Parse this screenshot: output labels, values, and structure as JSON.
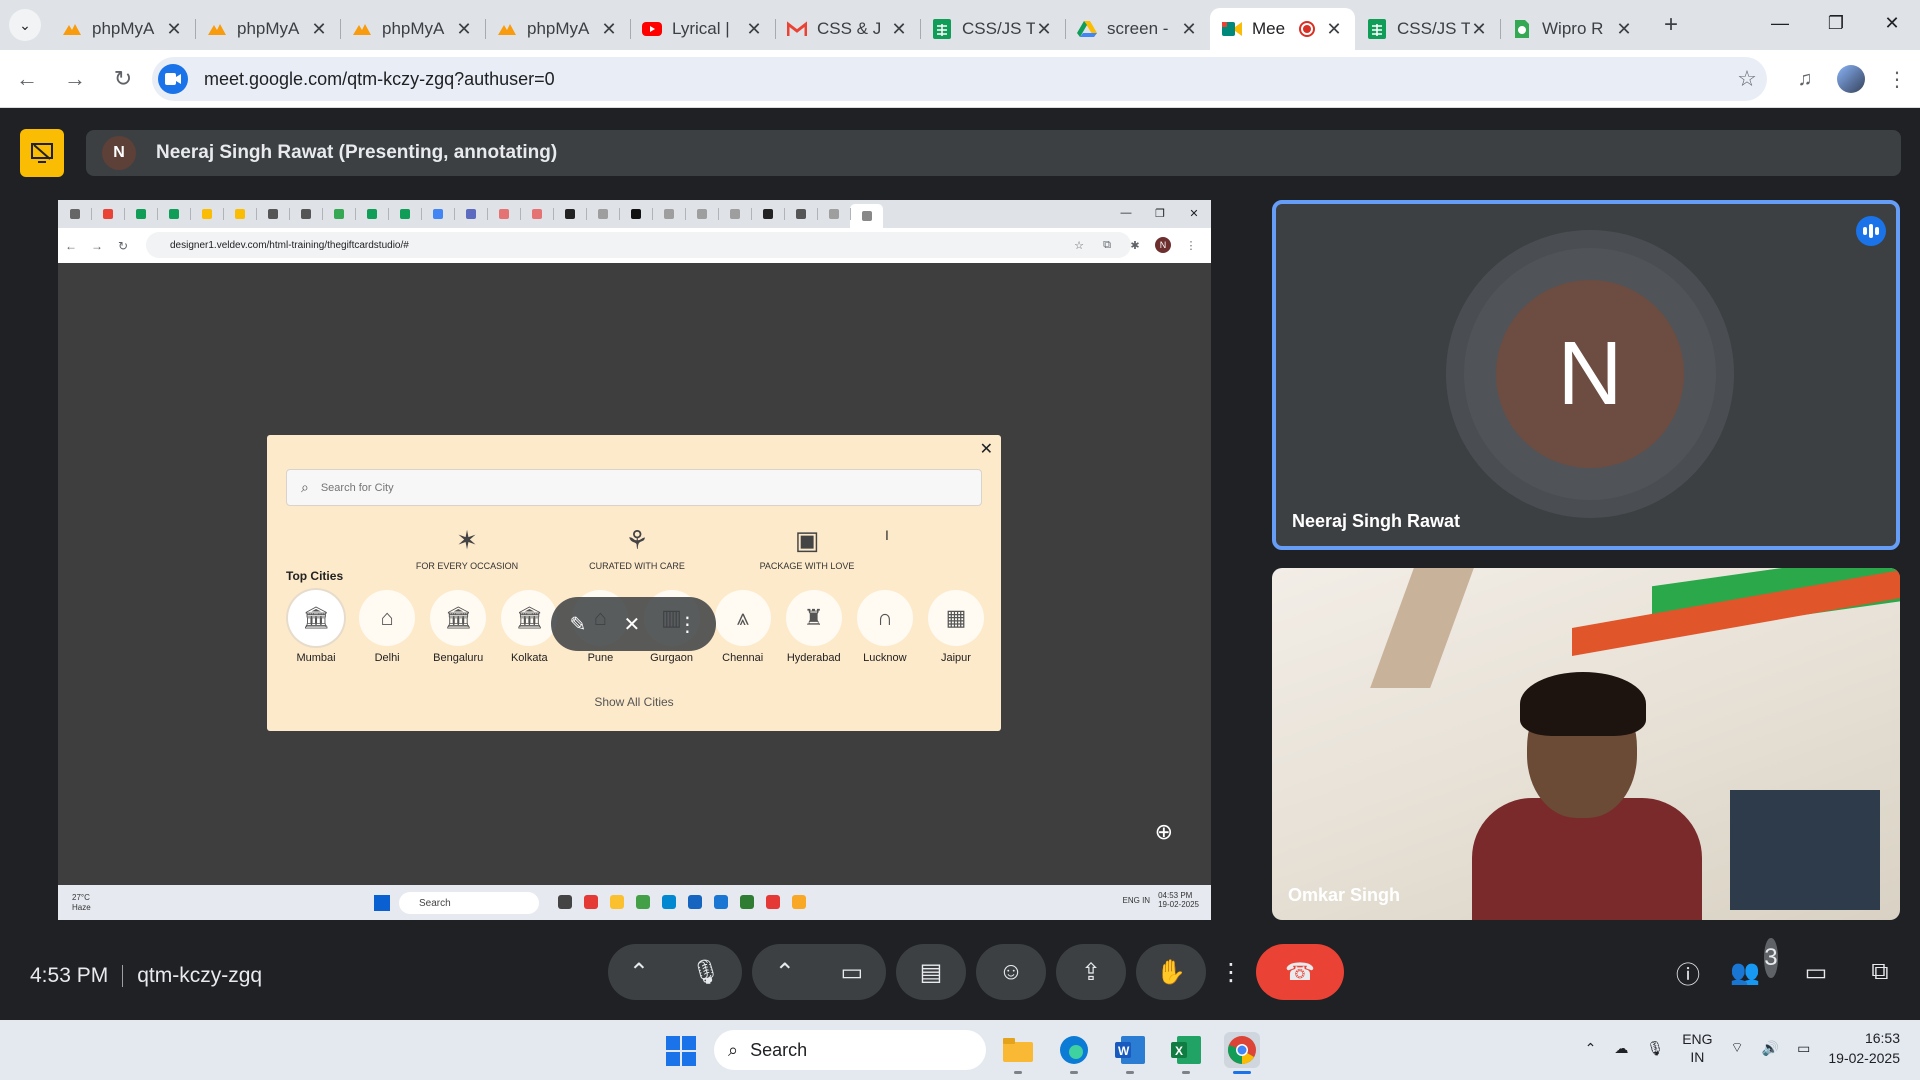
{
  "browser": {
    "tabs": [
      {
        "title": "phpMyA",
        "icon": "phpmyadmin-icon",
        "color": "#f89c0e"
      },
      {
        "title": "phpMyA",
        "icon": "phpmyadmin-icon",
        "color": "#f89c0e"
      },
      {
        "title": "phpMyA",
        "icon": "phpmyadmin-icon",
        "color": "#f89c0e"
      },
      {
        "title": "phpMyA",
        "icon": "phpmyadmin-icon",
        "color": "#f89c0e"
      },
      {
        "title": "Lyrical |",
        "icon": "youtube-icon",
        "color": "#ff0000"
      },
      {
        "title": "CSS & J",
        "icon": "gmail-icon",
        "color": "#ea4335"
      },
      {
        "title": "CSS/JS T",
        "icon": "sheets-icon",
        "color": "#0f9d58"
      },
      {
        "title": "screen -",
        "icon": "drive-icon",
        "color": "#fbbc04"
      },
      {
        "title": "Mee",
        "icon": "meet-icon",
        "color": "#00897b"
      },
      {
        "title": "CSS/JS T",
        "icon": "sheets-icon",
        "color": "#0f9d58"
      },
      {
        "title": "Wipro R",
        "icon": "wipro-icon",
        "color": "#34a853"
      }
    ],
    "url": "meet.google.com/qtm-kczy-zgq?authuser=0"
  },
  "meet": {
    "presenter_initial": "N",
    "presenter_label": "Neeraj Singh Rawat (Presenting, annotating)",
    "self_tile": {
      "initial": "N",
      "name": "Neeraj Singh Rawat"
    },
    "cam_tile": {
      "name": "Omkar Singh"
    },
    "time": "4:53 PM",
    "code": "qtm-kczy-zgq",
    "people_count": "3"
  },
  "shared_screen": {
    "url": "designer1.veldev.com/html-training/thegiftcardstudio/#",
    "avatar": "N",
    "modal": {
      "search_placeholder": "Search for City",
      "features": [
        "FOR EVERY OCCASION",
        "CURATED WITH CARE",
        "PACKAGE WITH LOVE"
      ],
      "top_cities_title": "Top Cities",
      "cities": [
        "Mumbai",
        "Delhi",
        "Bengaluru",
        "Kolkata",
        "Pune",
        "Gurgaon",
        "Chennai",
        "Hyderabad",
        "Lucknow",
        "Jaipur"
      ],
      "show_all": "Show All Cities"
    },
    "taskbar": {
      "weather_temp": "27°C",
      "weather_desc": "Haze",
      "search": "Search",
      "lang1": "ENG",
      "lang2": "IN",
      "time": "04:53 PM",
      "date": "19-02-2025"
    }
  },
  "taskbar": {
    "search": "Search",
    "lang1": "ENG",
    "lang2": "IN",
    "time": "16:53",
    "date": "19-02-2025"
  }
}
